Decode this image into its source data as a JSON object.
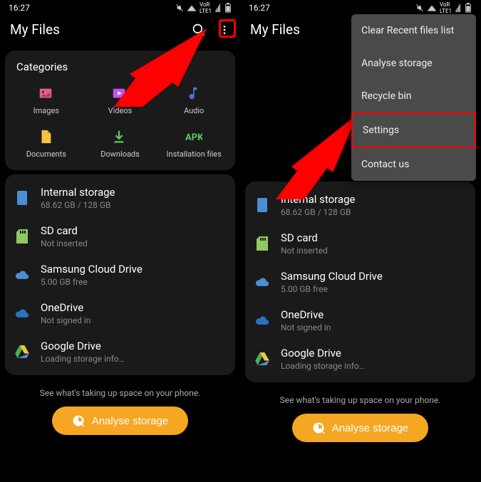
{
  "statusBar": {
    "time": "16:27",
    "indicators": "VoLTE"
  },
  "appBar": {
    "title": "My Files"
  },
  "categories": {
    "heading": "Categories",
    "items": [
      {
        "label": "Images",
        "icon": "images",
        "color": "#e85d8e"
      },
      {
        "label": "Videos",
        "icon": "videos",
        "color": "#c154f0"
      },
      {
        "label": "Audio",
        "icon": "audio",
        "color": "#4a6fd4"
      },
      {
        "label": "Documents",
        "icon": "documents",
        "color": "#f5c542"
      },
      {
        "label": "Downloads",
        "icon": "downloads",
        "color": "#5fc95f"
      },
      {
        "label": "Installation files",
        "icon": "apk",
        "color": "#5fc95f"
      }
    ]
  },
  "storage": {
    "items": [
      {
        "title": "Internal storage",
        "sub": "68.62 GB / 128 GB",
        "icon": "internal",
        "color": "#4a8fd4"
      },
      {
        "title": "SD card",
        "sub": "Not inserted",
        "icon": "sd",
        "color": "#8fc95f"
      },
      {
        "title": "Samsung Cloud Drive",
        "sub": "5.00 GB free",
        "icon": "samsung-cloud",
        "color": "#4a8fd4"
      },
      {
        "title": "OneDrive",
        "sub": "Not signed in",
        "icon": "onedrive",
        "color": "#2a72c4"
      },
      {
        "title": "Google Drive",
        "sub": "Loading storage info…",
        "icon": "google-drive",
        "color": "#f5c542"
      }
    ]
  },
  "hint": "See what's taking up space on your phone.",
  "analyseBtn": "Analyse storage",
  "menu": {
    "items": [
      "Clear Recent files list",
      "Analyse storage",
      "Recycle bin",
      "Settings",
      "Contact us"
    ],
    "highlightedIndex": 3
  }
}
